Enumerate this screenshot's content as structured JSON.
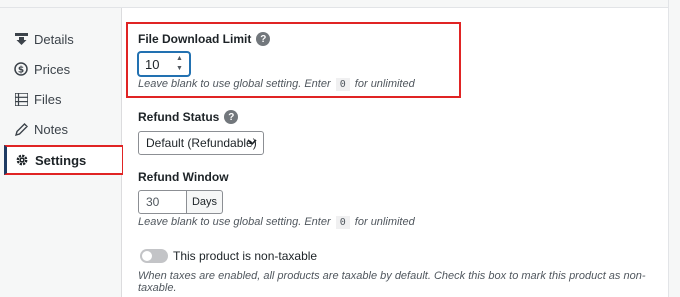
{
  "sidebar": {
    "items": [
      {
        "label": "Details",
        "icon": "download-icon"
      },
      {
        "label": "Prices",
        "icon": "dollar-icon"
      },
      {
        "label": "Files",
        "icon": "list-icon"
      },
      {
        "label": "Notes",
        "icon": "pencil-icon"
      },
      {
        "label": "Settings",
        "icon": "gear-icon"
      }
    ]
  },
  "file_download_limit": {
    "label": "File Download Limit",
    "help": "?",
    "value": "10",
    "hint_before": "Leave blank to use global setting. Enter",
    "hint_code": "0",
    "hint_after": "for unlimited"
  },
  "refund_status": {
    "label": "Refund Status",
    "help": "?",
    "selected": "Default (Refundable)"
  },
  "refund_window": {
    "label": "Refund Window",
    "value": "30",
    "unit": "Days",
    "hint_before": "Leave blank to use global setting. Enter",
    "hint_code": "0",
    "hint_after": "for unlimited"
  },
  "taxable": {
    "label": "This product is non-taxable",
    "hint": "When taxes are enabled, all products are taxable by default. Check this box to mark this product as non-taxable."
  },
  "colors": {
    "highlight": "#e02424",
    "focus": "#2271b1",
    "active_border": "#1e3b63"
  }
}
